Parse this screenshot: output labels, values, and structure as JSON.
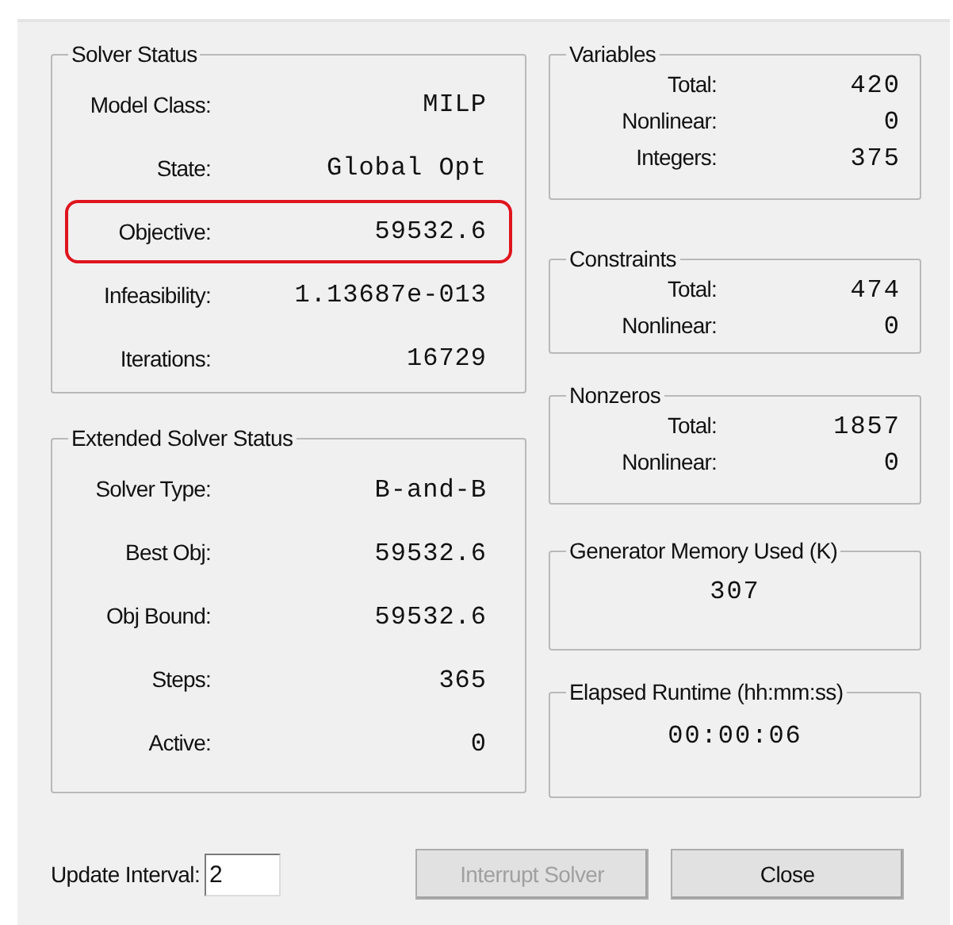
{
  "solver_status": {
    "title": "Solver Status",
    "rows": [
      {
        "label": "Model Class:",
        "value": "MILP",
        "highlighted": false
      },
      {
        "label": "State:",
        "value": "Global Opt",
        "highlighted": false
      },
      {
        "label": "Objective:",
        "value": "59532.6",
        "highlighted": true
      },
      {
        "label": "Infeasibility:",
        "value": "1.13687e-013",
        "highlighted": false
      },
      {
        "label": "Iterations:",
        "value": "16729",
        "highlighted": false
      }
    ]
  },
  "extended_solver_status": {
    "title": "Extended Solver Status",
    "rows": [
      {
        "label": "Solver Type:",
        "value": "B-and-B",
        "highlighted": false
      },
      {
        "label": "Best Obj:",
        "value": "59532.6",
        "highlighted": false
      },
      {
        "label": "Obj Bound:",
        "value": "59532.6",
        "highlighted": false
      },
      {
        "label": "Steps:",
        "value": "365",
        "highlighted": false
      },
      {
        "label": "Active:",
        "value": "0",
        "highlighted": false
      }
    ]
  },
  "variables": {
    "title": "Variables",
    "rows": [
      {
        "label": "Total:",
        "value": "420"
      },
      {
        "label": "Nonlinear:",
        "value": "0"
      },
      {
        "label": "Integers:",
        "value": "375"
      }
    ]
  },
  "constraints": {
    "title": "Constraints",
    "rows": [
      {
        "label": "Total:",
        "value": "474"
      },
      {
        "label": "Nonlinear:",
        "value": "0"
      }
    ]
  },
  "nonzeros": {
    "title": "Nonzeros",
    "rows": [
      {
        "label": "Total:",
        "value": "1857"
      },
      {
        "label": "Nonlinear:",
        "value": "0"
      }
    ]
  },
  "generator_memory": {
    "title": "Generator Memory Used (K)",
    "value": "307"
  },
  "elapsed_runtime": {
    "title": "Elapsed Runtime (hh:mm:ss)",
    "value": "00:00:06"
  },
  "update_interval": {
    "label": "Update Interval:",
    "value": "2"
  },
  "buttons": [
    {
      "label": "Interrupt Solver",
      "disabled": true
    },
    {
      "label": "Close",
      "disabled": false
    }
  ]
}
